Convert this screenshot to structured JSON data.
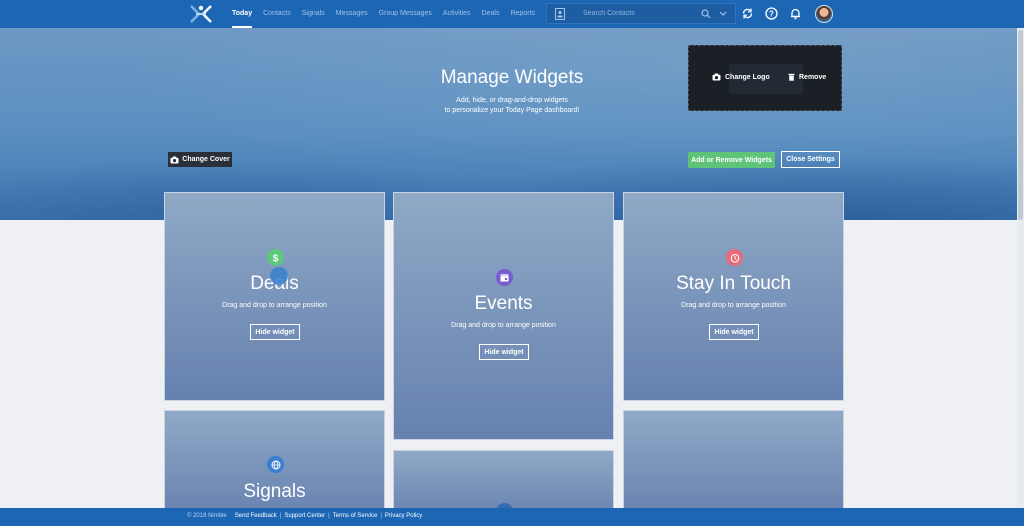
{
  "nav": {
    "items": [
      "Today",
      "Contacts",
      "Signals",
      "Messages",
      "Group Messages",
      "Activities",
      "Deals",
      "Reports"
    ],
    "active": "Today",
    "search_placeholder": "Search Contacts"
  },
  "cover": {
    "title": "Manage Widgets",
    "subtitle_line1": "Add, hide, or drag-and-drop widgets",
    "subtitle_line2": "to personalize your Today Page dashboard!",
    "change_logo": "Change Logo",
    "remove": "Remove",
    "change_cover": "Change Cover",
    "add_remove_widgets": "Add or Remove Widgets",
    "close_settings": "Close Settings"
  },
  "widgets": [
    {
      "title": "Deals",
      "subtitle": "Drag and drop to arrange position",
      "hide": "Hide widget",
      "icon": "dollar-icon",
      "color": "#5cc879"
    },
    {
      "title": "Events",
      "subtitle": "Drag and drop to arrange position",
      "hide": "Hide widget",
      "icon": "calendar-icon",
      "color": "#7b5bd0"
    },
    {
      "title": "Stay In Touch",
      "subtitle": "Drag and drop to arrange position",
      "hide": "Hide widget",
      "icon": "alarm-icon",
      "color": "#e86a7a"
    },
    {
      "title": "Signals",
      "icon": "globe-icon",
      "color": "#3a80d0"
    }
  ],
  "footer": {
    "copyright": "© 2018 Nimble",
    "links": [
      "Send Feedback",
      "Support Center",
      "Terms of Service",
      "Privacy Policy"
    ]
  },
  "colors": {
    "nav_bg": "#1c66b4",
    "accent_green": "#5fc37a"
  }
}
